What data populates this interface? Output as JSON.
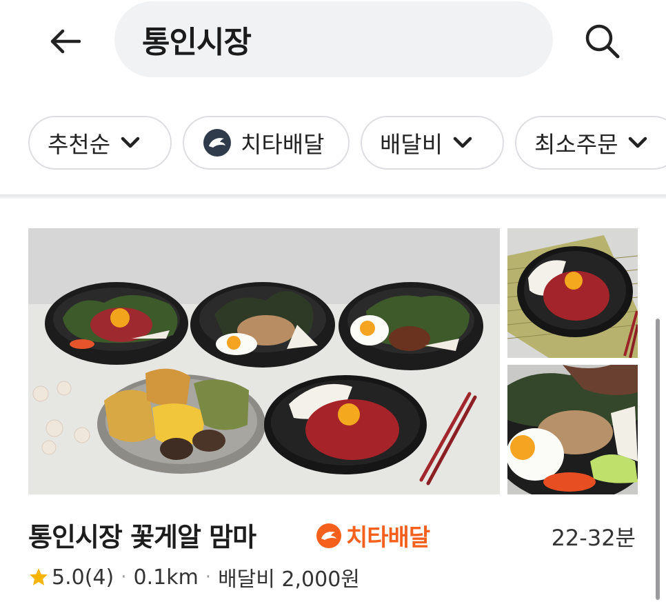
{
  "header": {
    "search_value": "통인시장",
    "back_icon": "arrow-left-icon",
    "search_icon": "search-icon"
  },
  "filters": [
    {
      "label": "추천순",
      "icon": "chevron-down-icon"
    },
    {
      "label": "치타배달",
      "icon": "cheetah-logo-icon"
    },
    {
      "label": "배달비",
      "icon": "chevron-down-icon"
    },
    {
      "label": "최소주문",
      "icon": "chevron-down-icon"
    }
  ],
  "store": {
    "name": "통인시장 꽃게알 맘마",
    "badge_label": "치타배달",
    "eta": "22-32분",
    "rating": "5.0",
    "review_count": "(4)",
    "distance": "0.1km",
    "delivery_fee": "배달비 2,000원",
    "separator": "·"
  },
  "colors": {
    "accent": "#f5601d",
    "star": "#f7b500",
    "chip_border": "#dcdde0",
    "search_bg": "#f1f2f4",
    "cheetah_chip_logo": "#2f3a4a"
  }
}
